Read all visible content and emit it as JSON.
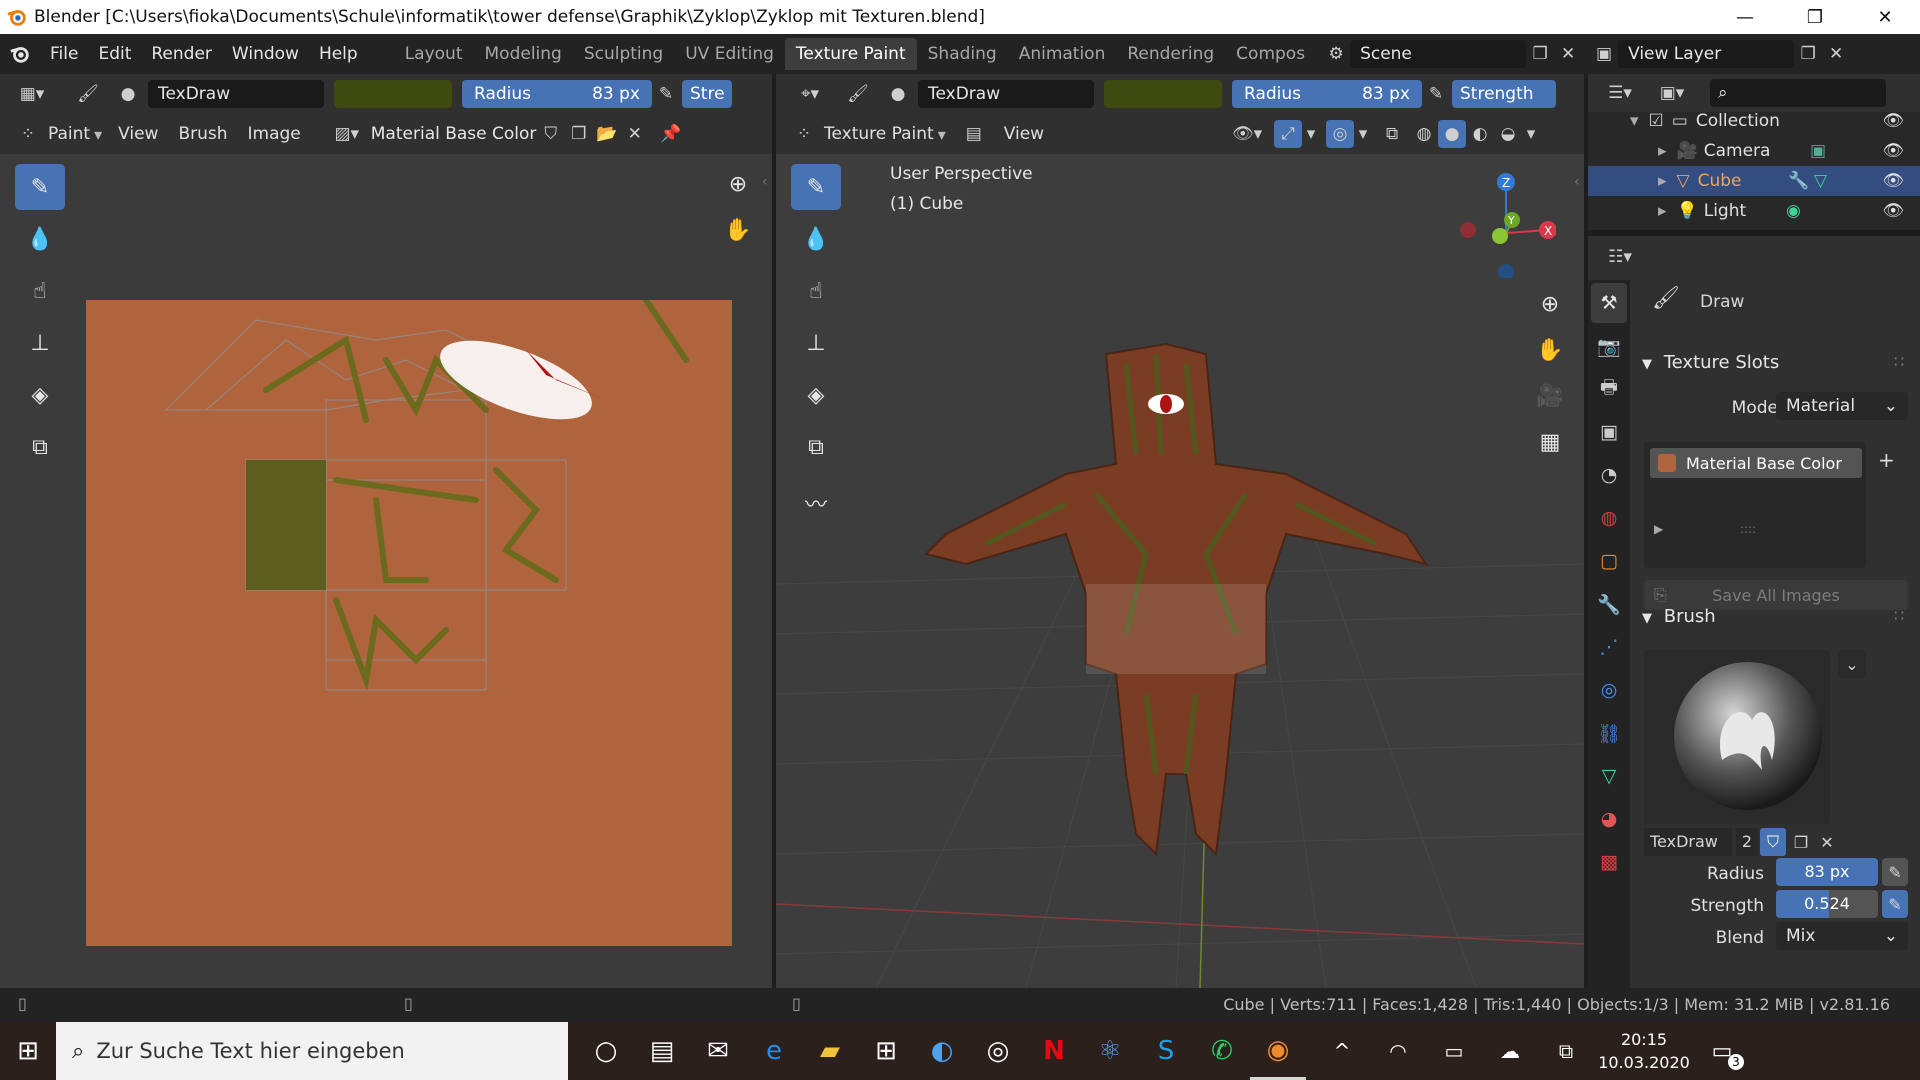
{
  "titlebar": {
    "title": "Blender [C:\\Users\\fioka\\Documents\\Schule\\informatik\\tower defense\\Graphik\\Zyklop\\Zyklop mit Texturen.blend]",
    "minimize": "—",
    "maximize": "❐",
    "close": "✕"
  },
  "menu": [
    "File",
    "Edit",
    "Render",
    "Window",
    "Help"
  ],
  "workspaces": [
    "Layout",
    "Modeling",
    "Sculpting",
    "UV Editing",
    "Texture Paint",
    "Shading",
    "Animation",
    "Rendering",
    "Compos"
  ],
  "scene": {
    "label": "Scene",
    "view_layer": "View Layer"
  },
  "image_editor": {
    "brush_name": "TexDraw",
    "radius_label": "Radius",
    "radius_value": "83 px",
    "strength_label": "Stre",
    "mode": "Paint",
    "menus": [
      "View",
      "Brush",
      "Image"
    ],
    "image_name": "Material Base Color",
    "color_hex": "#3e4a10"
  },
  "viewport": {
    "brush_name": "TexDraw",
    "radius_label": "Radius",
    "radius_value": "83 px",
    "strength_label": "Strength",
    "mode": "Texture Paint",
    "view_menu": "View",
    "overlay_line1": "User Perspective",
    "overlay_line2": "(1) Cube",
    "gizmo": {
      "z": "Z",
      "y": "Y",
      "x": "X"
    }
  },
  "outliner": {
    "items": [
      {
        "label": "Collection",
        "icon": "collection-icon"
      },
      {
        "label": "Camera",
        "icon": "camera-icon"
      },
      {
        "label": "Cube",
        "icon": "mesh-icon",
        "selected": true
      },
      {
        "label": "Light",
        "icon": "light-icon"
      }
    ]
  },
  "properties": {
    "tool_name": "Draw",
    "texture_slots_header": "Texture Slots",
    "mode_label": "Mode",
    "mode_value": "Material",
    "slot_item": "Material Base Color",
    "slot_more": "::::",
    "save_all": "Save All Images",
    "brush_header": "Brush",
    "brush_name": "TexDraw",
    "brush_users": "2",
    "radius_label": "Radius",
    "radius_value": "83 px",
    "strength_label": "Strength",
    "strength_value": "0.524",
    "strength_fraction": 0.524,
    "blend_label": "Blend",
    "blend_value": "Mix"
  },
  "statusbar": {
    "text": "Cube | Verts:711 | Faces:1,428 | Tris:1,440 | Objects:1/3 | Mem: 31.2 MiB | v2.81.16"
  },
  "taskbar": {
    "search_placeholder": "Zur Suche Text hier eingeben",
    "time": "20:15",
    "date": "10.03.2020",
    "notification_count": "3"
  },
  "colors": {
    "accent": "#4772b3",
    "canvas_orange": "#b0643e",
    "selected_orange": "#f0a35a"
  }
}
